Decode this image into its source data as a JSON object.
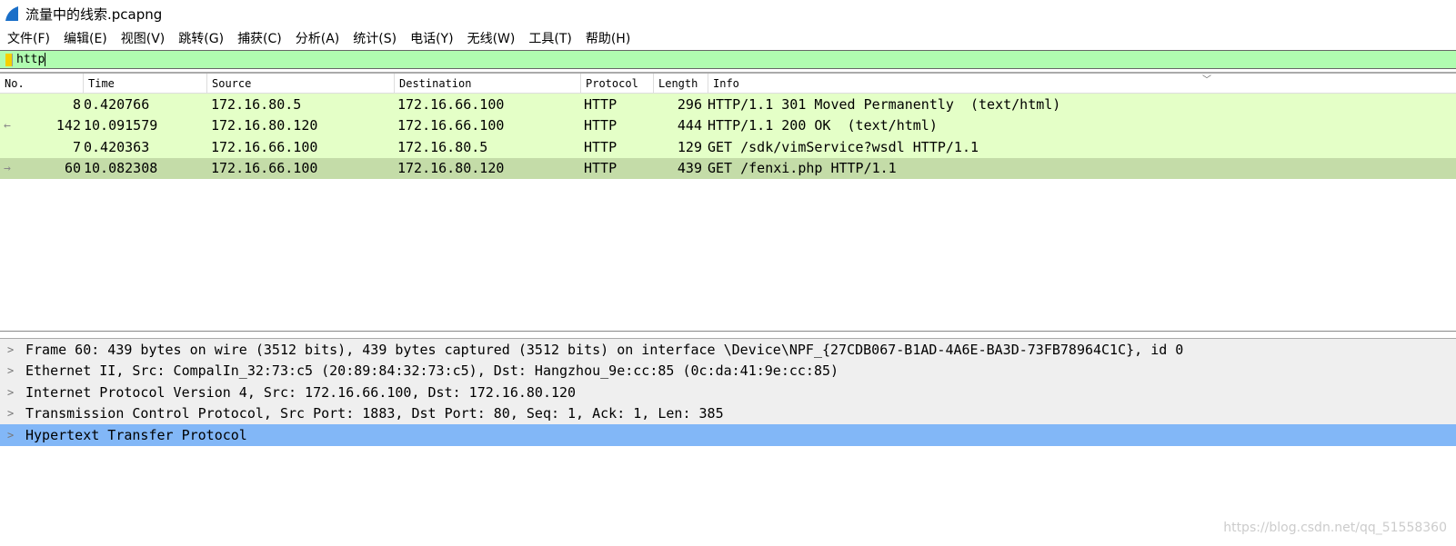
{
  "window": {
    "title": "流量中的线索.pcapng"
  },
  "menu": [
    "文件(F)",
    "编辑(E)",
    "视图(V)",
    "跳转(G)",
    "捕获(C)",
    "分析(A)",
    "统计(S)",
    "电话(Y)",
    "无线(W)",
    "工具(T)",
    "帮助(H)"
  ],
  "filter": {
    "value": "http"
  },
  "columns": [
    "No.",
    "Time",
    "Source",
    "Destination",
    "Protocol",
    "Length",
    "Info"
  ],
  "packets": [
    {
      "no": "8",
      "time": "0.420766",
      "src": "172.16.80.5",
      "dst": "172.16.66.100",
      "proto": "HTTP",
      "len": "296",
      "info": "HTTP/1.1 301 Moved Permanently  (text/html)",
      "selected": false,
      "rel": ""
    },
    {
      "no": "142",
      "time": "10.091579",
      "src": "172.16.80.120",
      "dst": "172.16.66.100",
      "proto": "HTTP",
      "len": "444",
      "info": "HTTP/1.1 200 OK  (text/html)",
      "selected": false,
      "rel": "←"
    },
    {
      "no": "7",
      "time": "0.420363",
      "src": "172.16.66.100",
      "dst": "172.16.80.5",
      "proto": "HTTP",
      "len": "129",
      "info": "GET /sdk/vimService?wsdl HTTP/1.1",
      "selected": false,
      "rel": ""
    },
    {
      "no": "60",
      "time": "10.082308",
      "src": "172.16.66.100",
      "dst": "172.16.80.120",
      "proto": "HTTP",
      "len": "439",
      "info": "GET /fenxi.php HTTP/1.1",
      "selected": true,
      "rel": "→"
    }
  ],
  "details": [
    {
      "text": "Frame 60: 439 bytes on wire (3512 bits), 439 bytes captured (3512 bits) on interface \\Device\\NPF_{27CDB067-B1AD-4A6E-BA3D-73FB78964C1C}, id 0",
      "selected": false
    },
    {
      "text": "Ethernet II, Src: CompalIn_32:73:c5 (20:89:84:32:73:c5), Dst: Hangzhou_9e:cc:85 (0c:da:41:9e:cc:85)",
      "selected": false
    },
    {
      "text": "Internet Protocol Version 4, Src: 172.16.66.100, Dst: 172.16.80.120",
      "selected": false
    },
    {
      "text": "Transmission Control Protocol, Src Port: 1883, Dst Port: 80, Seq: 1, Ack: 1, Len: 385",
      "selected": false
    },
    {
      "text": "Hypertext Transfer Protocol",
      "selected": true
    }
  ],
  "watermark": "https://blog.csdn.net/qq_51558360"
}
